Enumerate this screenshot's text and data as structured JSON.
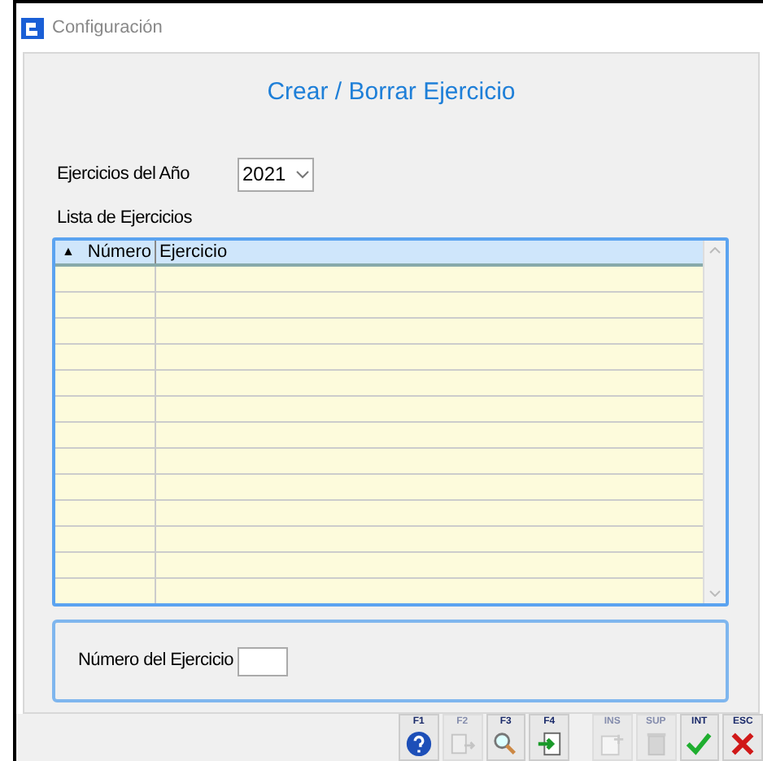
{
  "window": {
    "title": "Configuración"
  },
  "heading": "Crear / Borrar Ejercicio",
  "year_field": {
    "label": "Ejercicios del Año",
    "value": "2021"
  },
  "list": {
    "label": "Lista de Ejercicios",
    "sort_mark": "▲",
    "columns": [
      {
        "label": "Número"
      },
      {
        "label": "Ejercicio"
      }
    ]
  },
  "number_field": {
    "label": "Número del Ejercicio"
  },
  "toolbar": [
    {
      "key": "F1",
      "kind": "help",
      "disabled": false
    },
    {
      "key": "F2",
      "kind": "export",
      "disabled": true
    },
    {
      "key": "F3",
      "kind": "search",
      "disabled": false
    },
    {
      "key": "F4",
      "kind": "enter",
      "disabled": false
    },
    {
      "key": "INS",
      "kind": "new",
      "disabled": true
    },
    {
      "key": "SUP",
      "kind": "delete",
      "disabled": true
    },
    {
      "key": "INT",
      "kind": "accept",
      "disabled": false
    },
    {
      "key": "ESC",
      "kind": "cancel",
      "disabled": false
    }
  ]
}
